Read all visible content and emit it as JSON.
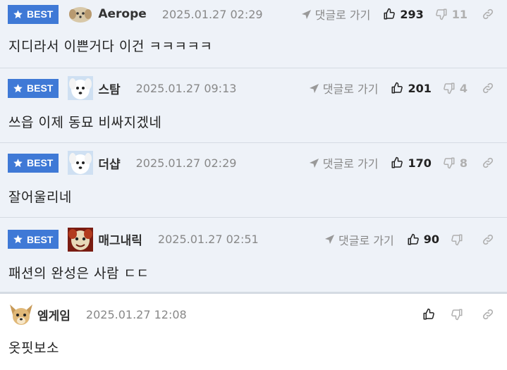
{
  "badge_label": "BEST",
  "reply_label": "댓글로 가기",
  "colors": {
    "badge_bg": "#3f79d6",
    "best_row_bg": "#eef2f8",
    "divider": "#d5dbe3"
  },
  "comments": [
    {
      "best": true,
      "avatar": "puppy-avatar-icon",
      "nickname": "Aerope",
      "date": "2025.01.27 02:29",
      "up": "293",
      "down": "11",
      "text": "지디라서 이쁜거다 이건 ㅋㅋㅋㅋㅋ"
    },
    {
      "best": true,
      "avatar": "white-dog-avatar-icon",
      "nickname": "스탐",
      "date": "2025.01.27 09:13",
      "up": "201",
      "down": "4",
      "text": "쓰읍 이제 동묘 비싸지겠네"
    },
    {
      "best": true,
      "avatar": "white-dog-avatar-icon",
      "nickname": "더샵",
      "date": "2025.01.27 02:29",
      "up": "170",
      "down": "8",
      "text": "잘어울리네"
    },
    {
      "best": true,
      "avatar": "red-face-avatar-icon",
      "nickname": "매그내릭",
      "date": "2025.01.27 02:51",
      "up": "90",
      "down": "",
      "text": "패션의 완성은 사람 ㄷㄷ"
    },
    {
      "best": false,
      "avatar": "chihuahua-avatar-icon",
      "nickname": "엠게임",
      "date": "2025.01.27 12:08",
      "up": "",
      "down": "",
      "text": "옷핏보소"
    }
  ]
}
